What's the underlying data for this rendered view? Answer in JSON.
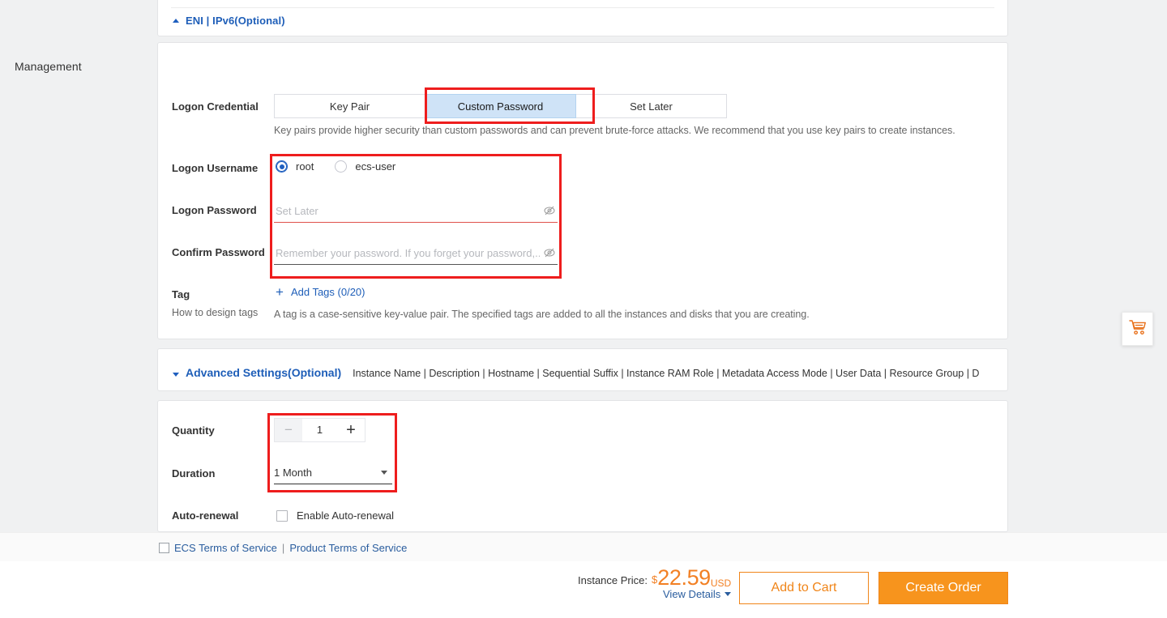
{
  "eni_panel": {
    "link_label": "ENI | IPv6(Optional)",
    "toggle_icon": "triangle-up-icon"
  },
  "management": {
    "section_title": "Management",
    "logon_credential": {
      "label": "Logon Credential",
      "options": [
        "Key Pair",
        "Custom Password",
        "Set Later"
      ],
      "selected": "Custom Password",
      "hint": "Key pairs provide higher security than custom passwords and can prevent brute-force attacks. We recommend that you use key pairs to create instances."
    },
    "logon_username": {
      "label": "Logon Username",
      "options": [
        "root",
        "ecs-user"
      ],
      "selected": "root"
    },
    "logon_password": {
      "label": "Logon Password",
      "value": "",
      "placeholder": "Set Later",
      "reveal_icon": "eye-slash-icon"
    },
    "confirm_password": {
      "label": "Confirm Password",
      "value": "",
      "placeholder": "Remember your password. If you forget your password,...",
      "reveal_icon": "eye-slash-icon"
    },
    "tag": {
      "label": "Tag",
      "add_label": "Add Tags (0/20)",
      "add_icon": "plus-icon",
      "howto_label": "How to design tags",
      "description": "A tag is a case-sensitive key-value pair. The specified tags are added to all the instances and disks that you are creating."
    }
  },
  "advanced": {
    "toggle_icon": "triangle-down-icon",
    "title": "Advanced Settings(Optional)",
    "subtitle": "Instance Name | Description | Hostname | Sequential Suffix | Instance RAM Role | Metadata Access Mode | User Data | Resource Group | D"
  },
  "purchase": {
    "quantity": {
      "label": "Quantity",
      "value": "1",
      "decrement_icon": "minus-icon",
      "increment_icon": "plus-icon"
    },
    "duration": {
      "label": "Duration",
      "value": "1 Month",
      "caret_icon": "chevron-down-icon"
    },
    "auto_renewal": {
      "label": "Auto-renewal",
      "checkbox_label": "Enable Auto-renewal",
      "checked": false
    }
  },
  "terms": {
    "checked": false,
    "links": [
      "ECS Terms of Service",
      "Product Terms of Service"
    ],
    "separator": "|"
  },
  "footer": {
    "price_label": "Instance Price:",
    "currency_symbol": "$",
    "price_amount": "22.59",
    "price_currency": "USD",
    "view_details": "View Details",
    "view_details_icon": "chevron-down-icon",
    "add_to_cart": "Add to Cart",
    "create_order": "Create Order"
  },
  "floating_cart": {
    "icon": "shopping-cart-icon"
  },
  "colors": {
    "accent_orange": "#f7941d",
    "link_blue": "#1e5eb8",
    "highlight_red": "#ee1d1d",
    "selected_segment_bg": "#cfe3f7",
    "radio_blue": "#1f5fbf",
    "page_bg": "#f0f1f2"
  }
}
